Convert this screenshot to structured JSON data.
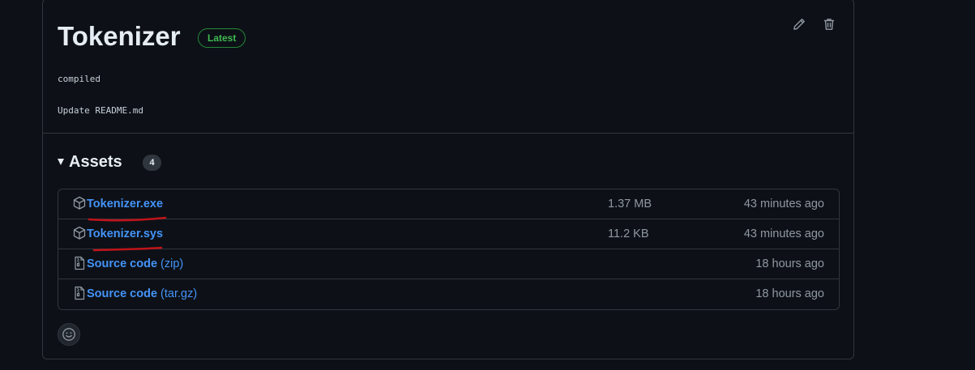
{
  "release": {
    "title": "Tokenizer",
    "badge": "Latest",
    "body_lines": [
      "compiled",
      "Update README.md"
    ]
  },
  "assets": {
    "heading": "Assets",
    "count": "4",
    "items": [
      {
        "name": "Tokenizer.exe",
        "suffix": "",
        "size": "1.37 MB",
        "time": "43 minutes ago",
        "icon": "package-icon"
      },
      {
        "name": "Tokenizer.sys",
        "suffix": "",
        "size": "11.2 KB",
        "time": "43 minutes ago",
        "icon": "package-icon"
      },
      {
        "name": "Source code",
        "suffix": " (zip)",
        "size": "",
        "time": "18 hours ago",
        "icon": "file-zip-icon"
      },
      {
        "name": "Source code",
        "suffix": " (tar.gz)",
        "size": "",
        "time": "18 hours ago",
        "icon": "file-zip-icon"
      }
    ]
  },
  "colors": {
    "background": "#0d1117",
    "border": "#30363d",
    "link": "#4493f8",
    "latest_green": "#3fb950",
    "annotation_red": "#c0131a"
  }
}
